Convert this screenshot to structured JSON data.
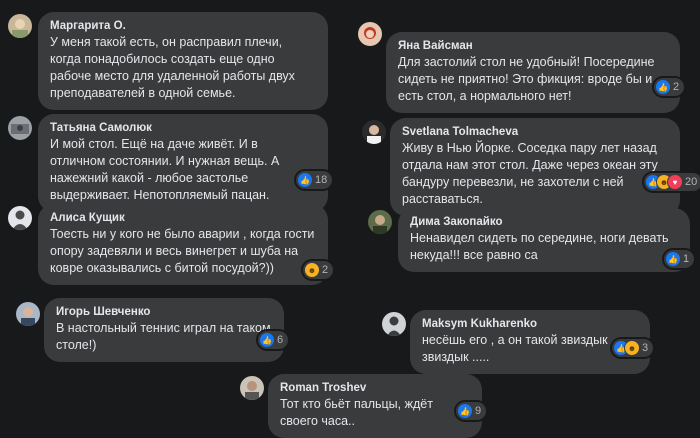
{
  "colors": {
    "background": "#18191a",
    "bubble": "#3a3b3c",
    "text": "#e4e6eb",
    "muted": "#b0b3b8",
    "like": "#1877f2",
    "haha": "#f7b125",
    "love": "#f33e58"
  },
  "comments": [
    {
      "name": "Маргарита О.",
      "text": "У меня такой есть, он расправил плечи, когда понадобилось создать еще одно рабоче место для удаленной работы двух преподавателей в одной семье.",
      "reactions": [],
      "count": ""
    },
    {
      "name": "Яна Вайсман",
      "text": "Для застолий стол не удобный! Посередине сидеть не приятно! Это фикция: вроде бы и есть стол, а нормального нет!",
      "reactions": [
        "like-icon"
      ],
      "count": "2"
    },
    {
      "name": "Татьяна Самолюк",
      "text": "И мой стол. Ещё на даче живёт. И в отличном состоянии. И нужная вещь. А нажежний какой - любое застолье выдерживает. Непотопляемый пацан.",
      "reactions": [
        "like-icon"
      ],
      "count": "18"
    },
    {
      "name": "Svetlana Tolmacheva",
      "text": "Живу в Нью Йорке. Соседка пару лет назад отдала нам этот стол. Даже через океан эту бандуру перевезли, не захотели с ней расставаться.",
      "reactions": [
        "like-icon",
        "haha-icon",
        "love-icon"
      ],
      "count": "20"
    },
    {
      "name": "Алиса Кущик",
      "text": "Тоесть ни у кого не было аварии , когда гости опору задевяли и весь винегрет и шуба на ковре оказывались с битой посудой?))",
      "reactions": [
        "haha-icon"
      ],
      "count": "2"
    },
    {
      "name": "Дима Закопайко",
      "text": "Ненавидел сидеть по середине, ноги девать некуда!!! все равно са",
      "reactions": [
        "like-icon"
      ],
      "count": "1"
    },
    {
      "name": "Игорь Шевченко",
      "text": "В настольный теннис играл на таком столе!)",
      "reactions": [
        "like-icon"
      ],
      "count": "6"
    },
    {
      "name": "Maksym Kukharenko",
      "text": "несёшь его , а он такой звиздык звиздык .....",
      "reactions": [
        "like-icon",
        "haha-icon"
      ],
      "count": "3"
    },
    {
      "name": "Roman Troshev",
      "text": "Тот кто бьёт пальцы, ждёт своего часа..",
      "reactions": [
        "like-icon"
      ],
      "count": "9"
    }
  ]
}
